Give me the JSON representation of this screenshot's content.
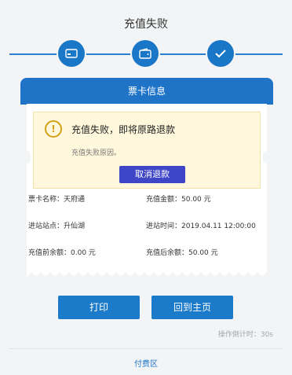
{
  "header": {
    "title": "充值失败"
  },
  "steps": [
    {
      "icon": "card-icon",
      "color": "#1a76c6"
    },
    {
      "icon": "wallet-icon",
      "color": "#1a76c6"
    },
    {
      "icon": "check-icon",
      "color": "#1a76c6"
    }
  ],
  "card": {
    "header_label": "票卡信息",
    "warning": {
      "title": "充值失败，即将原路退款",
      "reason": "充值失败原因。",
      "cancel_button": "取消退款"
    },
    "info": {
      "card_name": "票卡名称：天府通",
      "recharge_amount": "充值金额：50.00 元",
      "station": "进站站点：升仙湖",
      "entry_time": "进站时间：2019.04.11   12:00:00",
      "balance_before": "充值前余额：0.00 元",
      "balance_after": "充值后余额：50.00 元"
    }
  },
  "actions": {
    "print": "打印",
    "home": "回到主页"
  },
  "countdown": "操作倒计时：30s",
  "footer": "付费区",
  "colors": {
    "primary": "#1f74c8",
    "cancel": "#3f45c7",
    "warn_bg": "#fff8dc"
  }
}
